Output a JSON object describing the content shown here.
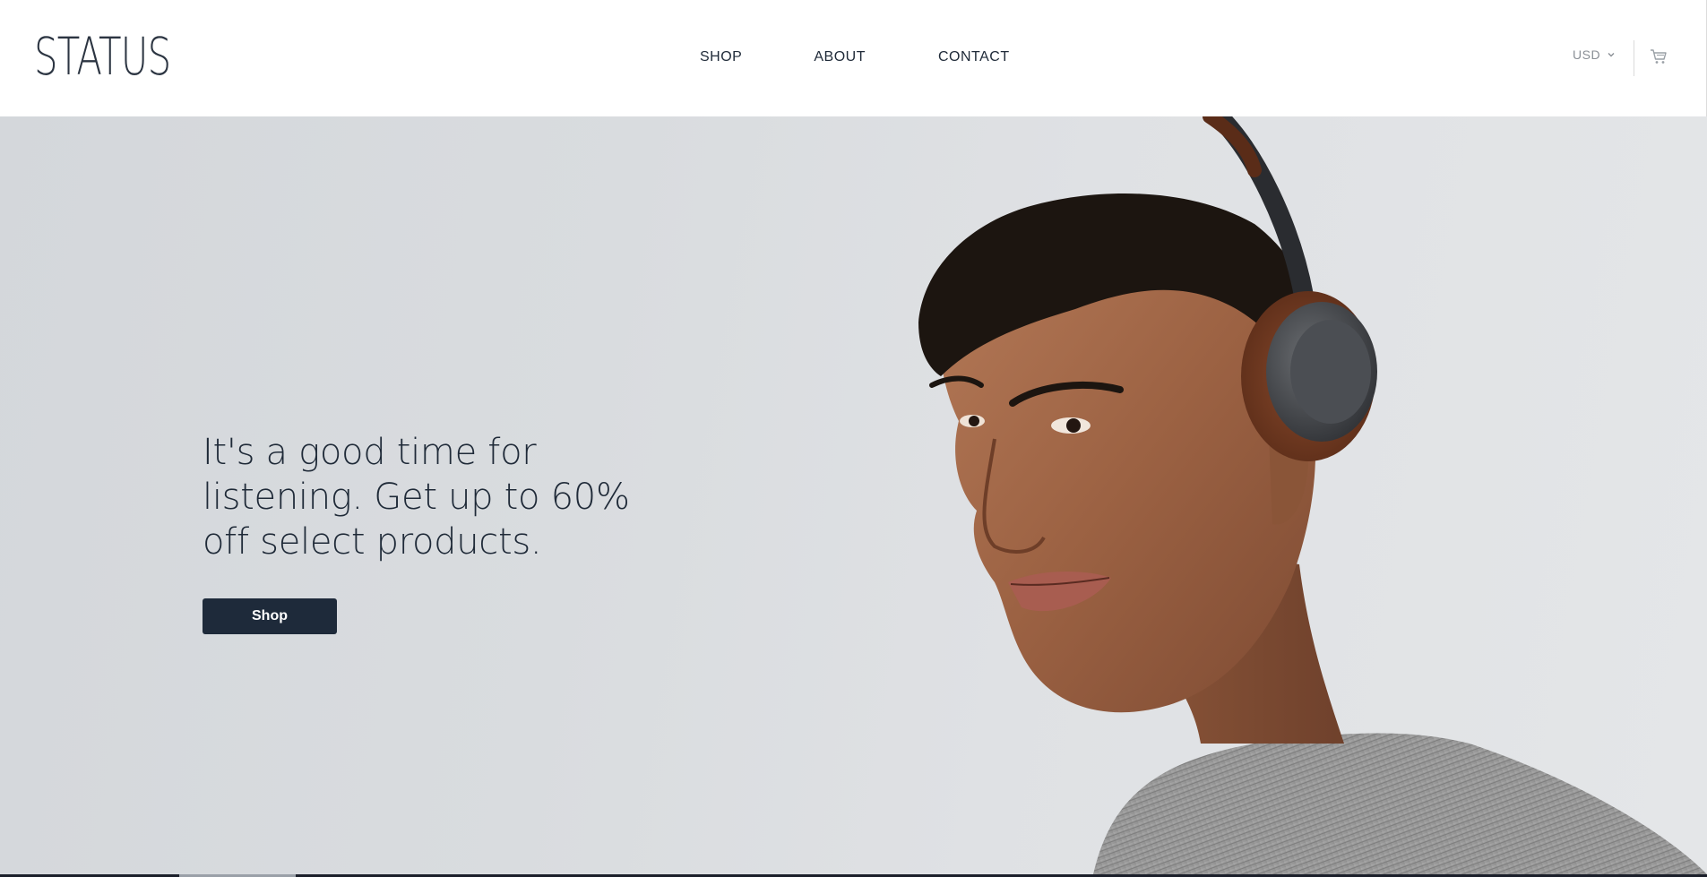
{
  "brand": {
    "logo_text": "STATUS"
  },
  "nav": {
    "items": [
      {
        "label": "SHOP"
      },
      {
        "label": "ABOUT"
      },
      {
        "label": "CONTACT"
      }
    ]
  },
  "currency": {
    "selected": "USD",
    "icon": "chevron-down-icon"
  },
  "cart": {
    "icon": "cart-icon"
  },
  "hero": {
    "headline": "It's a good time for listening. Get up to 60% off select products.",
    "cta_label": "Shop",
    "image": "man-wearing-headphones-photo"
  },
  "colors": {
    "text_dark": "#1f2a38",
    "button_bg": "#1e2a3a",
    "muted": "#8a8f96",
    "hero_bg": "#d9dcdf"
  }
}
